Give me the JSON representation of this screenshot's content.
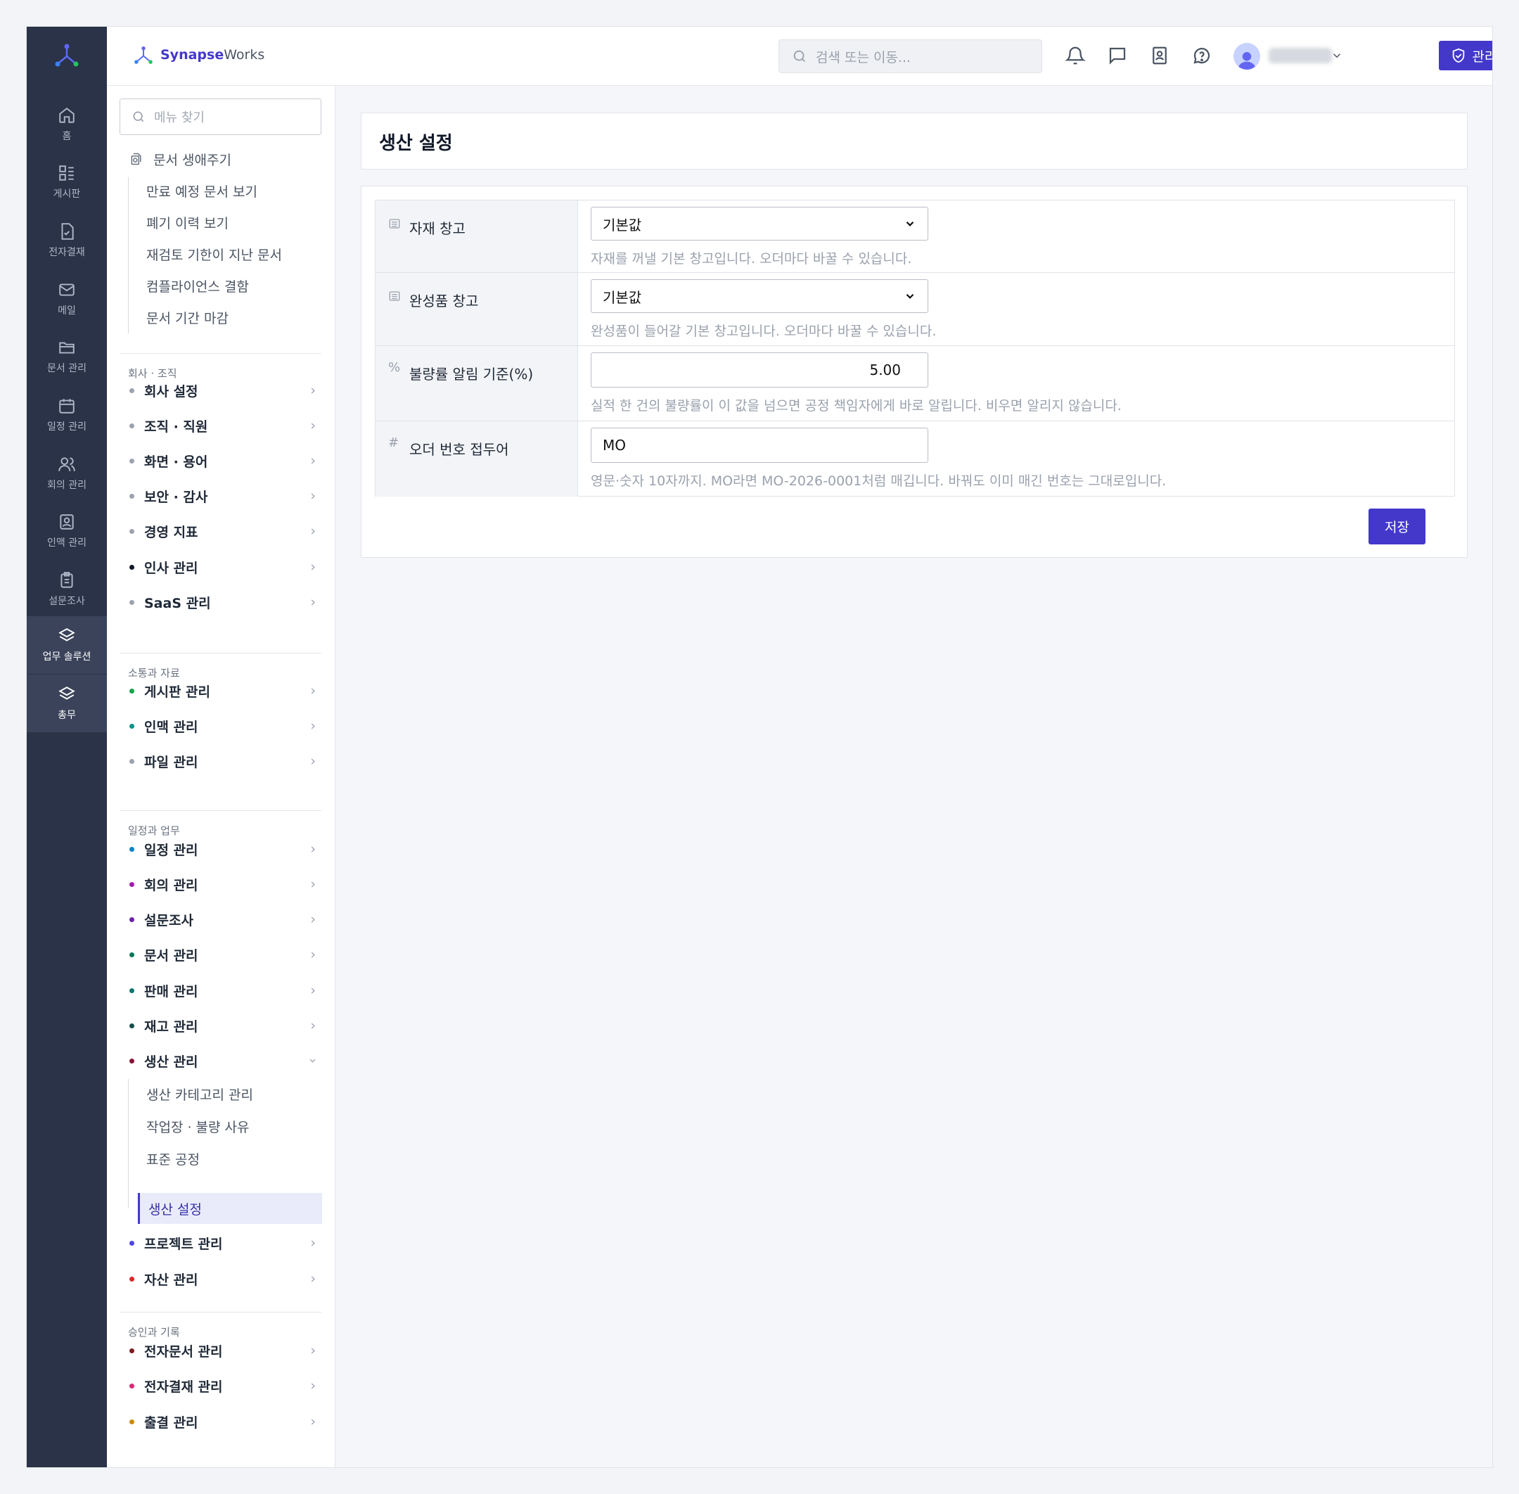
{
  "brand": {
    "name_bold": "Synapse",
    "name_rest": "Works"
  },
  "header": {
    "search_placeholder": "검색 또는 이동...",
    "admin_button": "관리자 메뉴"
  },
  "rail": {
    "items": [
      {
        "label": "홈",
        "icon": "home-icon"
      },
      {
        "label": "게시판",
        "icon": "board-icon"
      },
      {
        "label": "전자결재",
        "icon": "approval-icon"
      },
      {
        "label": "메일",
        "icon": "mail-icon"
      },
      {
        "label": "문서 관리",
        "icon": "folder-icon"
      },
      {
        "label": "일정 관리",
        "icon": "calendar-icon"
      },
      {
        "label": "회의 관리",
        "icon": "users-icon"
      },
      {
        "label": "인맥 관리",
        "icon": "contact-icon"
      },
      {
        "label": "설문조사",
        "icon": "survey-icon"
      },
      {
        "label": "업무 솔루션",
        "icon": "layers-icon"
      },
      {
        "label": "총무",
        "icon": "layers-icon"
      }
    ]
  },
  "sidemenu": {
    "search_placeholder": "메뉴 찾기",
    "lifecycle": {
      "title": "문서 생애주기",
      "items": [
        "만료 예정 문서 보기",
        "폐기 이력 보기",
        "재검토 기한이 지난 문서",
        "컴플라이언스 결함",
        "문서 기간 마감"
      ]
    },
    "sections": [
      {
        "title": "회사 · 조직",
        "items": [
          {
            "label": "회사 설정",
            "color": "#9ca3af"
          },
          {
            "label": "조직 · 직원",
            "color": "#9ca3af"
          },
          {
            "label": "화면 · 용어",
            "color": "#9ca3af"
          },
          {
            "label": "보안 · 감사",
            "color": "#9ca3af"
          },
          {
            "label": "경영 지표",
            "color": "#9ca3af"
          },
          {
            "label": "인사 관리",
            "color": "#111827"
          },
          {
            "label": "SaaS 관리",
            "color": "#9ca3af"
          }
        ]
      },
      {
        "title": "소통과 자료",
        "items": [
          {
            "label": "게시판 관리",
            "color": "#16a34a"
          },
          {
            "label": "인맥 관리",
            "color": "#0d9488"
          },
          {
            "label": "파일 관리",
            "color": "#9ca3af"
          }
        ]
      },
      {
        "title": "일정과 업무",
        "items": [
          {
            "label": "일정 관리",
            "color": "#0284c7"
          },
          {
            "label": "회의 관리",
            "color": "#a21caf"
          },
          {
            "label": "설문조사",
            "color": "#6b21a8"
          },
          {
            "label": "문서 관리",
            "color": "#047857"
          },
          {
            "label": "판매 관리",
            "color": "#0f766e"
          },
          {
            "label": "재고 관리",
            "color": "#134e4a"
          },
          {
            "label": "생산 관리",
            "color": "#881337"
          },
          {
            "label": "프로젝트 관리",
            "color": "#4f46e5"
          },
          {
            "label": "자산 관리",
            "color": "#dc2626"
          }
        ]
      },
      {
        "title": "승인과 기록",
        "items": [
          {
            "label": "전자문서 관리",
            "color": "#7f1d1d"
          },
          {
            "label": "전자결재 관리",
            "color": "#db2777"
          },
          {
            "label": "출결 관리",
            "color": "#ca8a04"
          }
        ]
      }
    ],
    "production_sub": [
      "생산 카테고리 관리",
      "작업장 · 불량 사유",
      "표준 공정",
      "생산 설정"
    ]
  },
  "page": {
    "title": "생산 설정",
    "fields": [
      {
        "icon": "warehouse-icon",
        "label": "자재 창고",
        "value": "기본값",
        "help": "자재를 꺼낼 기본 창고입니다. 오더마다 바꿀 수 있습니다."
      },
      {
        "icon": "warehouse-icon",
        "label": "완성품 창고",
        "value": "기본값",
        "help": "완성품이 들어갈 기본 창고입니다. 오더마다 바꿀 수 있습니다."
      },
      {
        "icon": "percent-icon",
        "label": "불량률 알림 기준(%)",
        "value": "5.00",
        "help": "실적 한 건의 불량률이 이 값을 넘으면 공정 책임자에게 바로 알립니다. 비우면 알리지 않습니다."
      },
      {
        "icon": "hash-icon",
        "label": "오더 번호 접두어",
        "value": "MO",
        "help": "영문·숫자 10자까지. MO라면 MO-2026-0001처럼 매깁니다. 바꿔도 이미 매긴 번호는 그대로입니다."
      }
    ],
    "save_button": "저장"
  },
  "colors": {
    "accent": "#4338ca",
    "rail": "#2b3348"
  }
}
